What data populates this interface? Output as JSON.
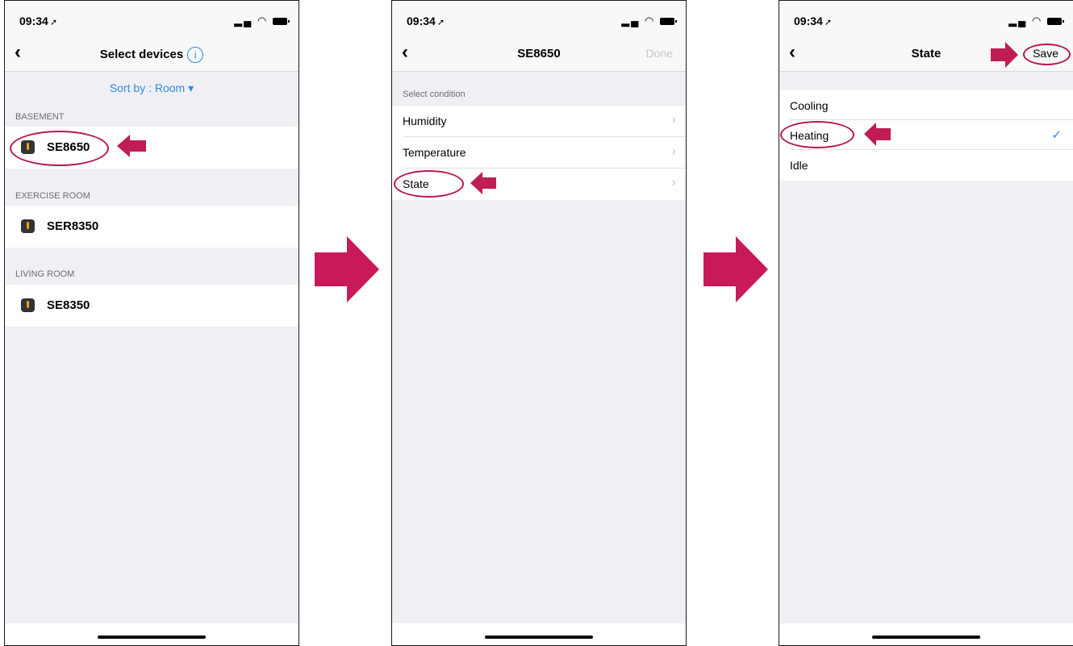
{
  "accent_color": "#2f8ae0",
  "annotation_color": "#c01d55",
  "status_bar": {
    "time": "09:34",
    "location_icon": "location-arrow-icon",
    "signal_icon": "signal-icon",
    "wifi_icon": "wifi-icon",
    "battery_icon": "battery-icon"
  },
  "screen1": {
    "title": "Select devices",
    "info_icon": "i",
    "sort_label": "Sort by : Room",
    "sort_caret": "▾",
    "sections": [
      {
        "label": "BASEMENT",
        "devices": [
          "SE8650"
        ]
      },
      {
        "label": "EXERCISE ROOM",
        "devices": [
          "SER8350"
        ]
      },
      {
        "label": "LIVING ROOM",
        "devices": [
          "SE8350"
        ]
      }
    ]
  },
  "screen2": {
    "title": "SE8650",
    "done_label": "Done",
    "section_label": "Select condition",
    "conditions": [
      "Humidity",
      "Temperature",
      "State"
    ]
  },
  "screen3": {
    "title": "State",
    "save_label": "Save",
    "options": [
      "Cooling",
      "Heating",
      "Idle"
    ],
    "selected": "Heating",
    "check_glyph": "✓"
  }
}
